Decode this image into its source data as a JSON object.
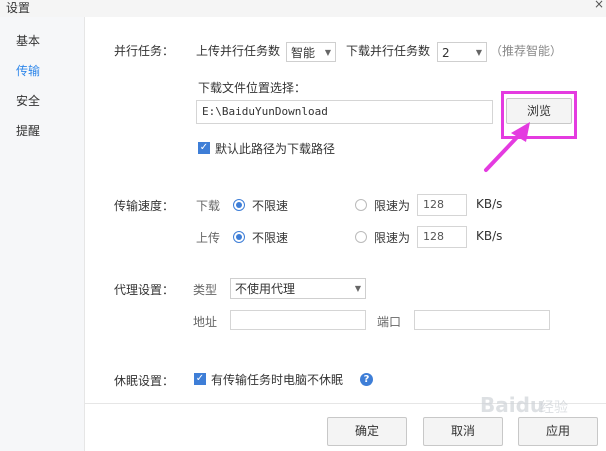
{
  "window": {
    "title": "设置",
    "close_symbol": "×"
  },
  "sidebar": {
    "items": [
      {
        "label": "基本",
        "active": false
      },
      {
        "label": "传输",
        "active": true
      },
      {
        "label": "安全",
        "active": false
      },
      {
        "label": "提醒",
        "active": false
      }
    ]
  },
  "parallel": {
    "section_label": "并行任务：",
    "upload_label": "上传并行任务数",
    "upload_value": "智能",
    "download_label": "下载并行任务数",
    "download_value": "2",
    "hint": "（推荐智能）"
  },
  "location": {
    "title": "下载文件位置选择：",
    "path": "E:\\BaiduYunDownload",
    "browse_label": "浏览",
    "default_checkbox_label": "默认此路径为下载路径",
    "default_checked": true
  },
  "speed": {
    "section_label": "传输速度：",
    "rows": [
      {
        "label": "下载",
        "unlimited_label": "不限速",
        "limit_label": "限速为",
        "limit_value": "128",
        "unit": "KB/s",
        "selected": "unlimited"
      },
      {
        "label": "上传",
        "unlimited_label": "不限速",
        "limit_label": "限速为",
        "limit_value": "128",
        "unit": "KB/s",
        "selected": "unlimited"
      }
    ]
  },
  "proxy": {
    "section_label": "代理设置：",
    "type_label": "类型",
    "type_value": "不使用代理",
    "address_label": "地址",
    "address_value": "",
    "port_label": "端口",
    "port_value": ""
  },
  "sleep": {
    "section_label": "休眠设置：",
    "checkbox_label": "有传输任务时电脑不休眠",
    "checked": true
  },
  "footer": {
    "ok_label": "确定",
    "cancel_label": "取消",
    "apply_label": "应用"
  },
  "annotation": {
    "highlight_color": "#e43be0"
  },
  "watermark": {
    "text": "Baidu 经验"
  }
}
